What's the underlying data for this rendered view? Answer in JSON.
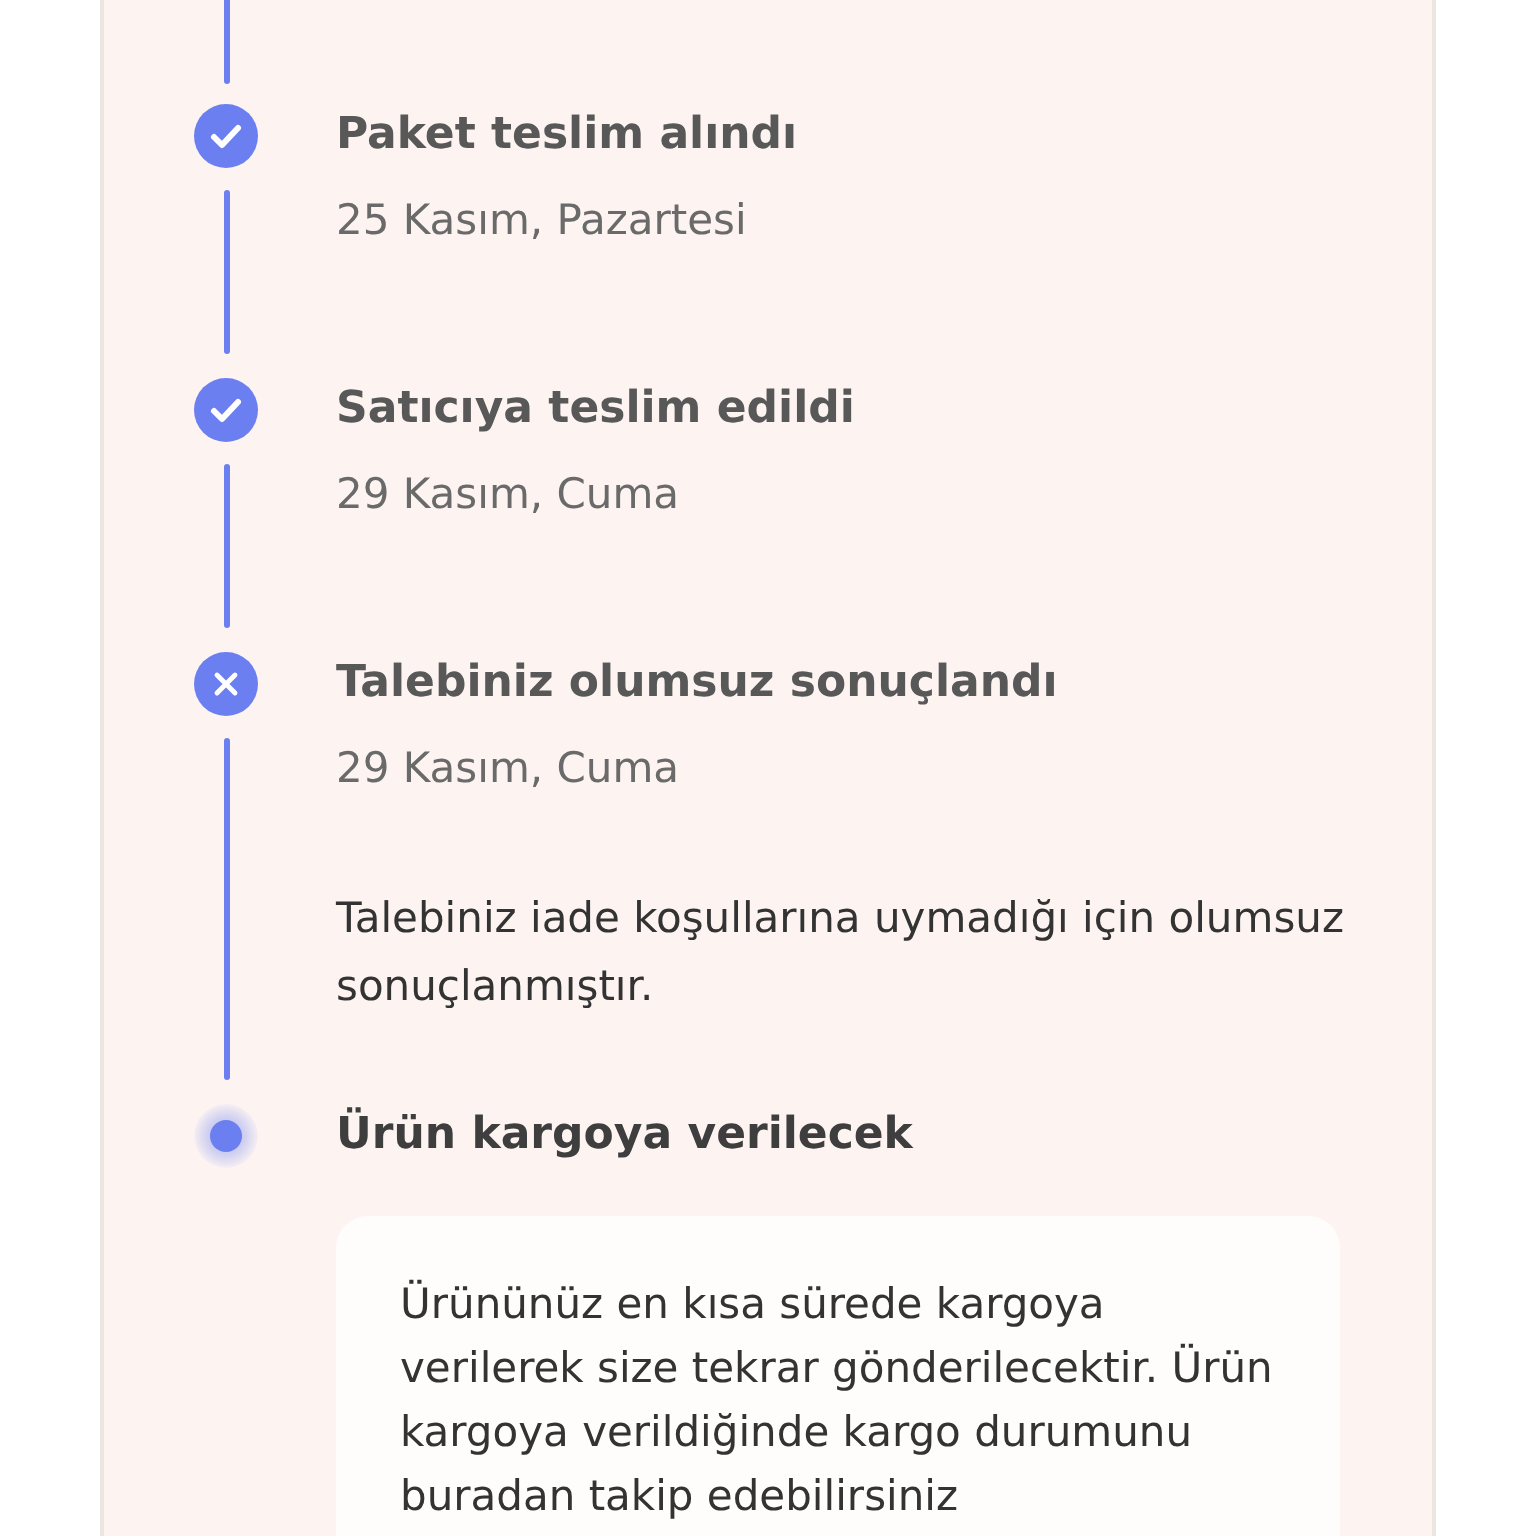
{
  "timeline": {
    "steps": [
      {
        "kind": "done",
        "title": "Paket teslim alındı",
        "date": "25 Kasım, Pazartesi"
      },
      {
        "kind": "done",
        "title": "Satıcıya teslim edildi",
        "date": "29 Kasım, Cuma"
      },
      {
        "kind": "rejected",
        "title": "Talebiniz olumsuz sonuçlandı",
        "date": "29 Kasım, Cuma",
        "description": "Talebiniz iade koşullarına uymadığı için olumsuz sonuçlanmıştır."
      },
      {
        "kind": "current",
        "title": "Ürün kargoya verilecek",
        "note": "Ürününüz en kısa sürede kargoya verilerek size tekrar gönderilecektir. Ürün kargoya verildiğinde kargo durumunu buradan takip edebilirsiniz"
      }
    ]
  }
}
